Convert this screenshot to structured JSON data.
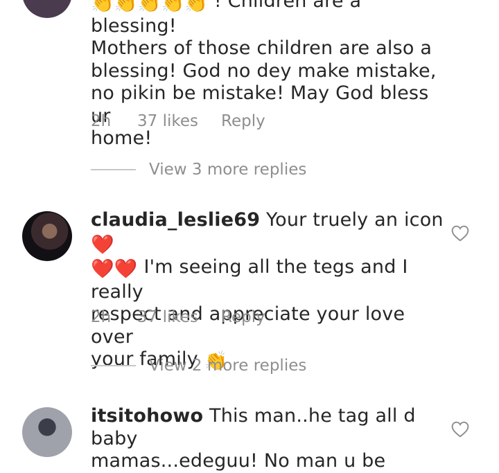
{
  "comments": [
    {
      "username": "",
      "text_lines": [
        " ! Children are a blessing!",
        "Mothers of those children are also a",
        "blessing! God no dey make mistake,",
        "no pikin be mistake! May God bless ur",
        "home!"
      ],
      "leading_emoji": "👏👏👏👏👏",
      "time": "2h",
      "likes": "37 likes",
      "reply": "Reply",
      "view_replies": "View 3 more replies",
      "avatar_color": "#4a3b4e"
    },
    {
      "username": "claudia_leslie69",
      "text_lines": [
        " Your truely an icon ",
        " I'm seeing all the tegs and I really",
        "respect and appreciate your love over",
        "your family "
      ],
      "emojis": {
        "heart": "❤️",
        "clap": "👏"
      },
      "time": "2h",
      "likes": "37 likes",
      "reply": "Reply",
      "view_replies": "View 2 more replies",
      "avatar_color": "#1c1a1e"
    },
    {
      "username": "itsitohowo",
      "text_lines": [
        " This man..he tag all d baby",
        "mamas...edeguu! No man u be"
      ],
      "avatar_color": "#7a7d86"
    }
  ],
  "icons": {
    "like": "heart-outline-icon"
  }
}
